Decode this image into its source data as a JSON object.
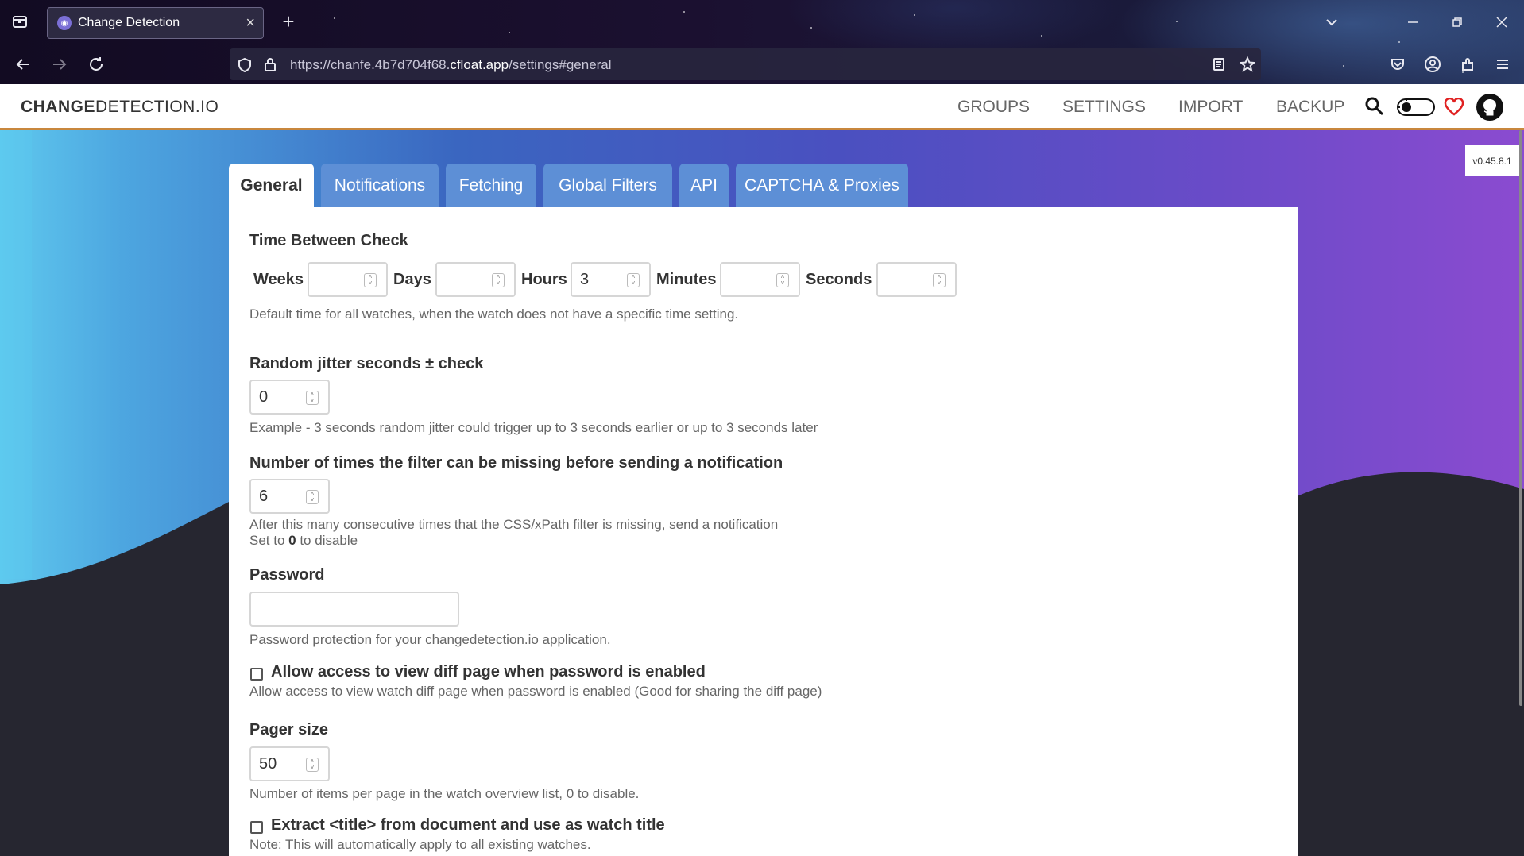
{
  "browser": {
    "tab_title": "Change Detection",
    "url_prefix": "https://chanfe.4b7d704f68.",
    "url_host": "cfloat.app",
    "url_path": "/settings#general"
  },
  "app": {
    "logo_bold": "CHANGE",
    "logo_rest": "DETECTION.IO",
    "nav": [
      "GROUPS",
      "SETTINGS",
      "IMPORT",
      "BACKUP"
    ],
    "version": "v0.45.8.1"
  },
  "settings_tabs": [
    "General",
    "Notifications",
    "Fetching",
    "Global Filters",
    "API",
    "CAPTCHA & Proxies"
  ],
  "active_tab": "General",
  "form": {
    "time_between_check": {
      "label": "Time Between Check",
      "weeks_label": "Weeks",
      "weeks_value": "",
      "days_label": "Days",
      "days_value": "",
      "hours_label": "Hours",
      "hours_value": "3",
      "minutes_label": "Minutes",
      "minutes_value": "",
      "seconds_label": "Seconds",
      "seconds_value": "",
      "help": "Default time for all watches, when the watch does not have a specific time setting."
    },
    "jitter": {
      "label": "Random jitter seconds ± check",
      "value": "0",
      "help": "Example - 3 seconds random jitter could trigger up to 3 seconds earlier or up to 3 seconds later"
    },
    "filter_missing": {
      "label": "Number of times the filter can be missing before sending a notification",
      "value": "6",
      "help1": "After this many consecutive times that the CSS/xPath filter is missing, send a notification",
      "help2_pre": "Set to ",
      "help2_bold": "0",
      "help2_post": " to disable"
    },
    "password": {
      "label": "Password",
      "value": "",
      "help": "Password protection for your changedetection.io application."
    },
    "allow_diff": {
      "label": "Allow access to view diff page when password is enabled",
      "checked": false,
      "help": "Allow access to view watch diff page when password is enabled (Good for sharing the diff page)"
    },
    "pager": {
      "label": "Pager size",
      "value": "50",
      "help": "Number of items per page in the watch overview list, 0 to disable."
    },
    "extract_title": {
      "label": "Extract <title> from document and use as watch title",
      "checked": false,
      "help": "Note: This will automatically apply to all existing watches."
    }
  }
}
